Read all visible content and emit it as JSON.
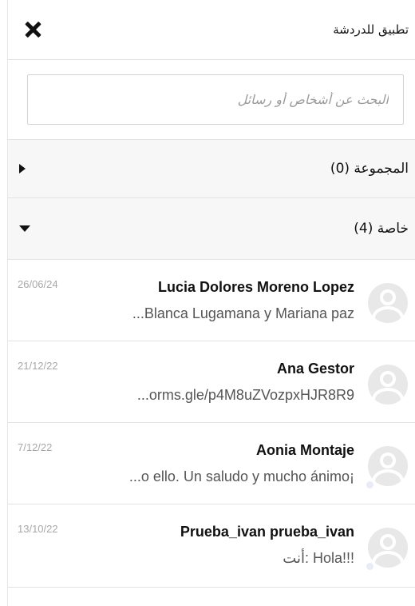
{
  "header": {
    "title": "تطبيق للدردشة",
    "close_icon": "close-icon"
  },
  "search": {
    "placeholder": "البحث عن أشخاص أو رسائل",
    "value": ""
  },
  "sections": [
    {
      "label": "المجموعة (0)",
      "icon": "caret-right-icon",
      "expanded": false
    },
    {
      "label": "خاصة (4)",
      "icon": "caret-down-icon",
      "expanded": true
    }
  ],
  "chats": [
    {
      "name": "Lucia Dolores Moreno Lopez",
      "preview": "...Blanca Lugamana y Mariana paz",
      "date": "26/06/24",
      "online": false
    },
    {
      "name": "Ana Gestor",
      "preview": "...orms.gle/p4M8uZVozpxHJR8R9",
      "date": "21/12/22",
      "online": false
    },
    {
      "name": "Aonia Montaje",
      "preview": "...o ello. Un saludo y mucho ánimo¡",
      "date": "7/12/22",
      "online": true
    },
    {
      "name": "Prueba_ivan prueba_ivan",
      "preview": "أنت: Hola!!!",
      "date": "13/10/22",
      "online": true
    }
  ]
}
